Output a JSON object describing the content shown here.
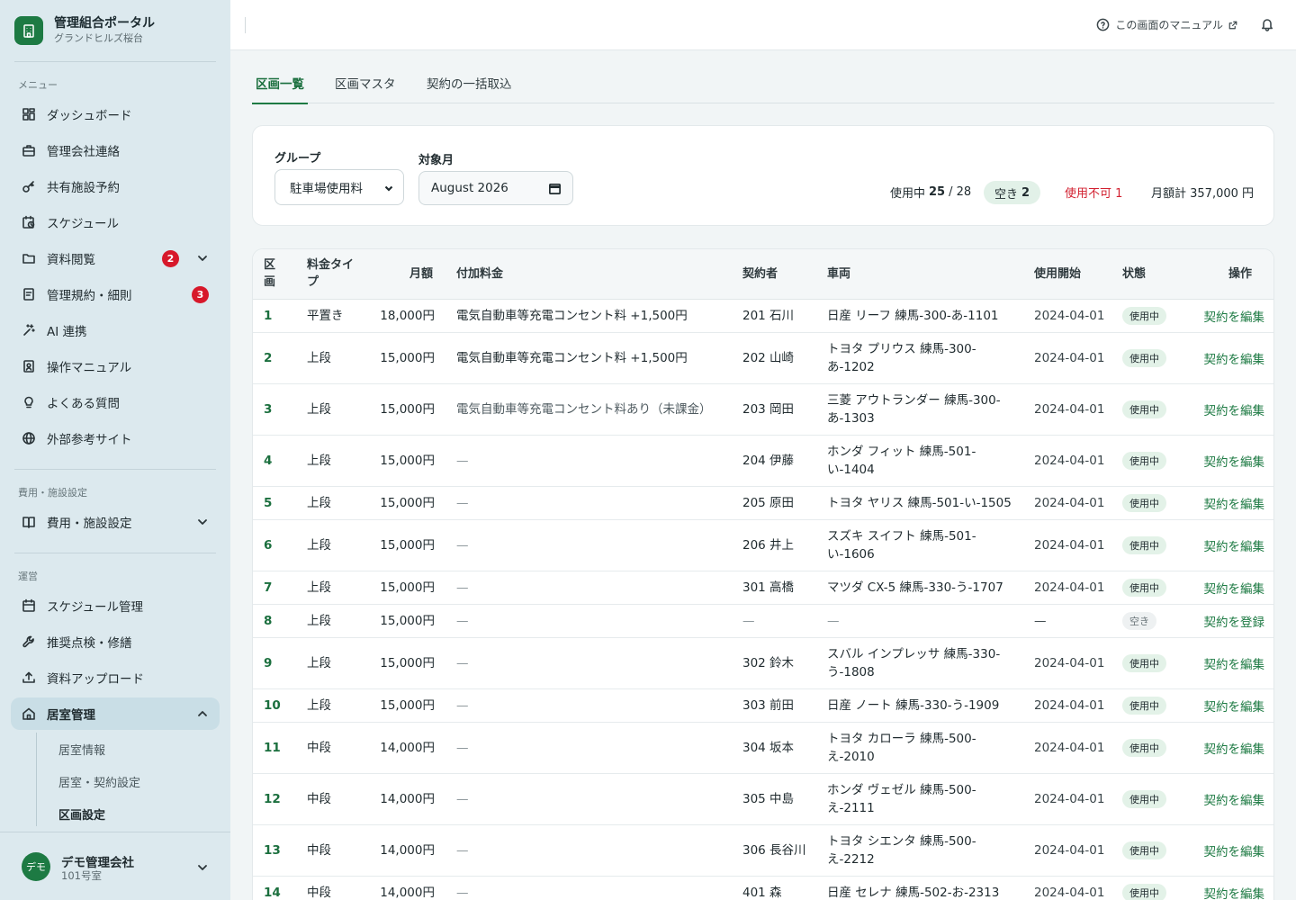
{
  "brand": {
    "title": "管理組合ポータル",
    "subtitle": "グランドヒルズ桜台"
  },
  "sidebar": {
    "menu_label": "メニュー",
    "menu": [
      {
        "label": "ダッシュボード",
        "icon": "dashboard-icon"
      },
      {
        "label": "管理会社連絡",
        "icon": "briefcase-icon"
      },
      {
        "label": "共有施設予約",
        "icon": "key-icon"
      },
      {
        "label": "スケジュール",
        "icon": "calendar-clock-icon"
      },
      {
        "label": "資料閲覧",
        "icon": "folder-icon",
        "badge": "2"
      },
      {
        "label": "管理規約・細則",
        "icon": "document-icon",
        "badge": "3"
      },
      {
        "label": "AI 連携",
        "icon": "sparkle-icon"
      },
      {
        "label": "操作マニュアル",
        "icon": "manual-icon"
      },
      {
        "label": "よくある質問",
        "icon": "lightbulb-icon"
      },
      {
        "label": "外部参考サイト",
        "icon": "globe-icon"
      }
    ],
    "settings_label": "費用・施設設定",
    "settings_item": "費用・施設設定",
    "ops_label": "運営",
    "ops": [
      {
        "label": "スケジュール管理",
        "icon": "calendar-icon"
      },
      {
        "label": "推奨点検・修繕",
        "icon": "wrench-icon"
      },
      {
        "label": "資料アップロード",
        "icon": "upload-icon"
      },
      {
        "label": "居室管理",
        "icon": "home-icon"
      }
    ],
    "sub": [
      "居室情報",
      "居室・契約設定",
      "区画設定"
    ],
    "user": {
      "avatar": "デモ",
      "name": "デモ管理会社",
      "room": "101号室"
    }
  },
  "topbar": {
    "manual_link": "この画面のマニュアル"
  },
  "tabs": [
    "区画一覧",
    "区画マスタ",
    "契約の一括取込"
  ],
  "filters": {
    "group_label": "グループ",
    "group_value": "駐車場使用料",
    "month_label": "対象月",
    "month_value": "August 2026"
  },
  "stats": {
    "used_label": "使用中",
    "used": "25",
    "total": "/ 28",
    "free_label": "空き",
    "free": "2",
    "unavailable": "使用不可 1",
    "monthly_total": "月額計 357,000 円"
  },
  "table": {
    "headers": [
      "区画",
      "料金タイプ",
      "月額",
      "付加料金",
      "契約者",
      "車両",
      "使用開始",
      "状態",
      "操作"
    ],
    "rows": [
      {
        "no": "1",
        "type": "平置き",
        "fee": "18,000円",
        "extra": "電気自動車等充電コンセント料 +1,500円",
        "contractor": "201 石川",
        "vehicle": "日産 リーフ 練馬-300-あ-1101",
        "start": "2024-04-01",
        "status": "使用中",
        "action": "契約を編集"
      },
      {
        "no": "2",
        "type": "上段",
        "fee": "15,000円",
        "extra": "電気自動車等充電コンセント料 +1,500円",
        "contractor": "202 山崎",
        "vehicle": "トヨタ プリウス 練馬-300-",
        "vehicle2": "あ-1202",
        "start": "2024-04-01",
        "status": "使用中",
        "action": "契約を編集"
      },
      {
        "no": "3",
        "type": "上段",
        "fee": "15,000円",
        "extra": "電気自動車等充電コンセント料あり（未課金）",
        "contractor": "203 岡田",
        "vehicle": "三菱 アウトランダー 練馬-300-",
        "vehicle2": "あ-1303",
        "start": "2024-04-01",
        "status": "使用中",
        "action": "契約を編集"
      },
      {
        "no": "4",
        "type": "上段",
        "fee": "15,000円",
        "extra": "—",
        "contractor": "204 伊藤",
        "vehicle": "ホンダ フィット 練馬-501-",
        "vehicle2": "い-1404",
        "start": "2024-04-01",
        "status": "使用中",
        "action": "契約を編集"
      },
      {
        "no": "5",
        "type": "上段",
        "fee": "15,000円",
        "extra": "—",
        "contractor": "205 原田",
        "vehicle": "トヨタ ヤリス 練馬-501-い-1505",
        "start": "2024-04-01",
        "status": "使用中",
        "action": "契約を編集"
      },
      {
        "no": "6",
        "type": "上段",
        "fee": "15,000円",
        "extra": "—",
        "contractor": "206 井上",
        "vehicle": "スズキ スイフト 練馬-501-",
        "vehicle2": "い-1606",
        "start": "2024-04-01",
        "status": "使用中",
        "action": "契約を編集"
      },
      {
        "no": "7",
        "type": "上段",
        "fee": "15,000円",
        "extra": "—",
        "contractor": "301 高橋",
        "vehicle": "マツダ CX-5 練馬-330-う-1707",
        "start": "2024-04-01",
        "status": "使用中",
        "action": "契約を編集"
      },
      {
        "no": "8",
        "type": "上段",
        "fee": "15,000円",
        "extra": "—",
        "contractor": "—",
        "vehicle": "—",
        "start": "—",
        "status": "空き",
        "action": "契約を登録"
      },
      {
        "no": "9",
        "type": "上段",
        "fee": "15,000円",
        "extra": "—",
        "contractor": "302 鈴木",
        "vehicle": "スバル インプレッサ 練馬-330-",
        "vehicle2": "う-1808",
        "start": "2024-04-01",
        "status": "使用中",
        "action": "契約を編集"
      },
      {
        "no": "10",
        "type": "上段",
        "fee": "15,000円",
        "extra": "—",
        "contractor": "303 前田",
        "vehicle": "日産 ノート 練馬-330-う-1909",
        "start": "2024-04-01",
        "status": "使用中",
        "action": "契約を編集"
      },
      {
        "no": "11",
        "type": "中段",
        "fee": "14,000円",
        "extra": "—",
        "contractor": "304 坂本",
        "vehicle": "トヨタ カローラ 練馬-500-",
        "vehicle2": "え-2010",
        "start": "2024-04-01",
        "status": "使用中",
        "action": "契約を編集"
      },
      {
        "no": "12",
        "type": "中段",
        "fee": "14,000円",
        "extra": "—",
        "contractor": "305 中島",
        "vehicle": "ホンダ ヴェゼル 練馬-500-",
        "vehicle2": "え-2111",
        "start": "2024-04-01",
        "status": "使用中",
        "action": "契約を編集"
      },
      {
        "no": "13",
        "type": "中段",
        "fee": "14,000円",
        "extra": "—",
        "contractor": "306 長谷川",
        "vehicle": "トヨタ シエンタ 練馬-500-",
        "vehicle2": "え-2212",
        "start": "2024-04-01",
        "status": "使用中",
        "action": "契約を編集"
      },
      {
        "no": "14",
        "type": "中段",
        "fee": "14,000円",
        "extra": "—",
        "contractor": "401 森",
        "vehicle": "日産 セレナ 練馬-502-お-2313",
        "start": "2024-04-01",
        "status": "使用中",
        "action": "契約を編集"
      }
    ]
  }
}
